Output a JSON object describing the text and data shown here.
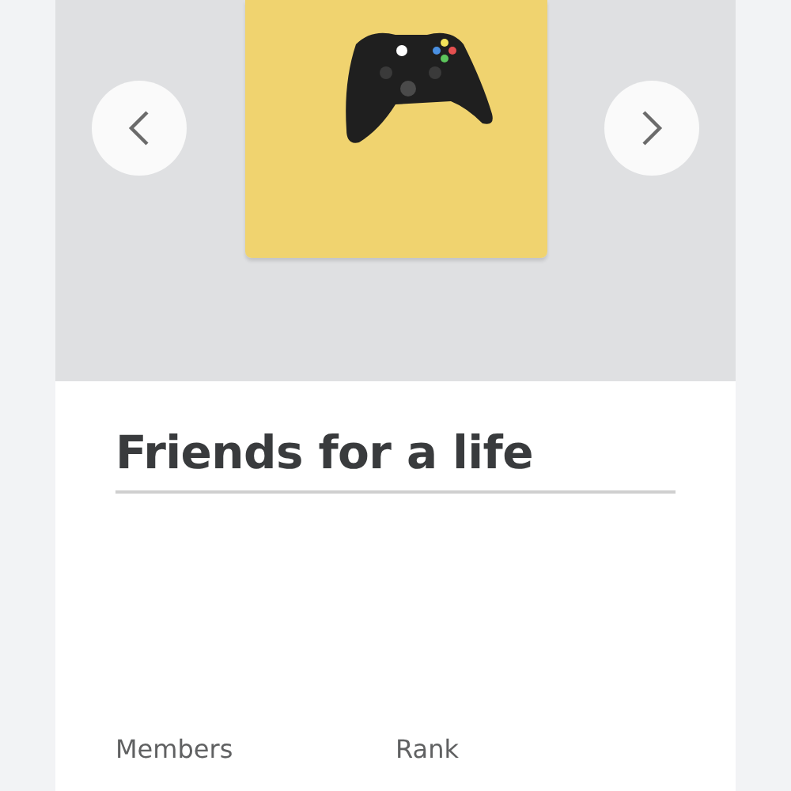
{
  "group": {
    "name": "Friends for a life"
  },
  "info_labels": [
    "Members",
    "Rank"
  ]
}
